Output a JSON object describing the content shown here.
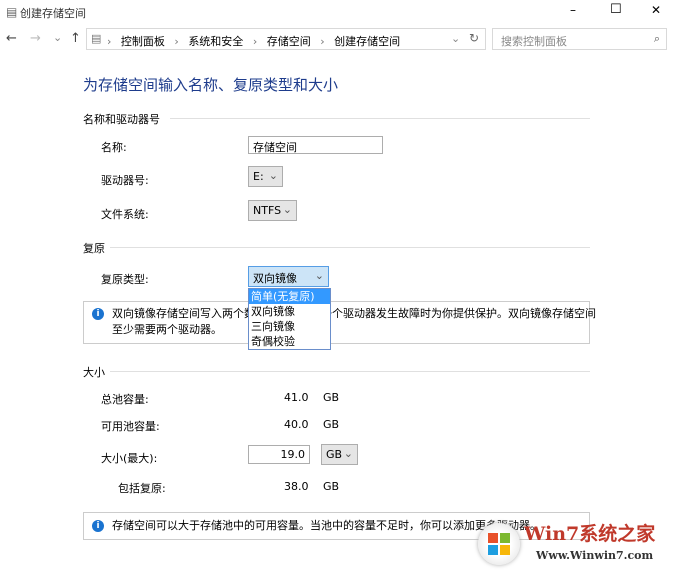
{
  "window": {
    "title": "创建存储空间",
    "minimize": "–",
    "maximize": "☐",
    "close": "✕"
  },
  "nav": {
    "back": "←",
    "forward": "→",
    "recent": "⌄",
    "up": "↑",
    "breadcrumb": [
      "控制面板",
      "系统和安全",
      "存储空间",
      "创建存储空间"
    ],
    "separator": "›",
    "refresh": "↻",
    "dropdown": "⌄",
    "search_placeholder": "搜索控制面板"
  },
  "page": {
    "title": "为存储空间输入名称、复原类型和大小"
  },
  "name_section": {
    "header": "名称和驱动器号",
    "name_label": "名称:",
    "name_value": "存储空间",
    "drive_label": "驱动器号:",
    "drive_value": "E:",
    "fs_label": "文件系统:",
    "fs_value": "NTFS"
  },
  "resiliency": {
    "header": "复原",
    "type_label": "复原类型:",
    "type_value": "双向镜像",
    "options": [
      "简单(无复原)",
      "双向镜像",
      "三向镜像",
      "奇偶校验"
    ],
    "highlighted_option": 0,
    "info_line1": "双向镜像存储空间写入两个数据副本，可在一个驱动器发生故障时为你提供保护。双向镜像存储空间",
    "info_line2": "至少需要两个驱动器。"
  },
  "size": {
    "header": "大小",
    "total_label": "总池容量:",
    "total_value": "41.0",
    "total_unit": "GB",
    "avail_label": "可用池容量:",
    "avail_value": "40.0",
    "avail_unit": "GB",
    "max_label": "大小(最大):",
    "max_value": "19.0",
    "max_unit": "GB",
    "incl_label": "包括复原:",
    "incl_value": "38.0",
    "incl_unit": "GB",
    "info": "存储空间可以大于存储池中的可用容量。当池中的容量不足时，你可以添加更多驱动器。"
  },
  "watermark": {
    "brand": "Win7系统之家",
    "url": "Www.Winwin7.com"
  },
  "colors": {
    "title": "#1e3c8c",
    "info_icon": "#1a73d0",
    "highlight": "#3399ff"
  }
}
